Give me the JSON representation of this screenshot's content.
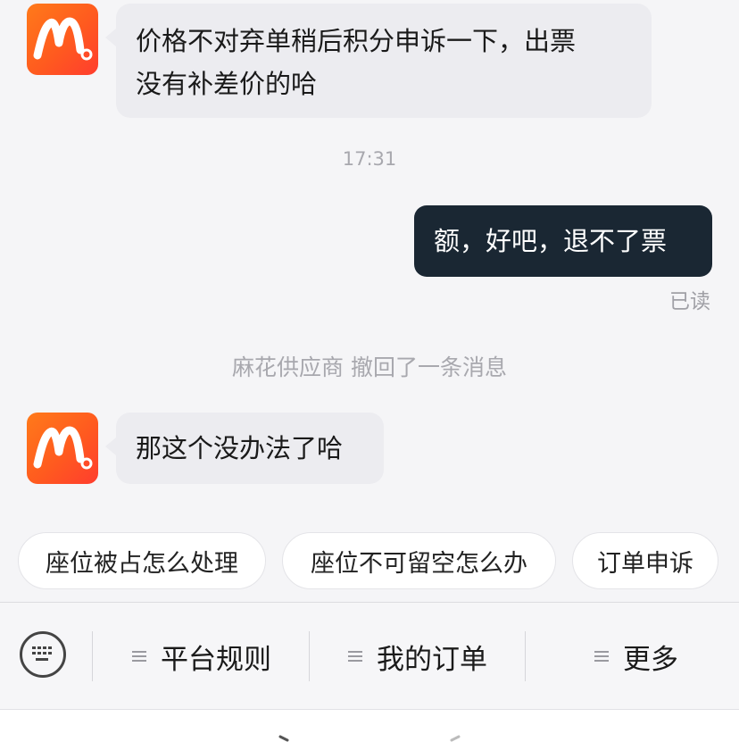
{
  "messages": {
    "incoming_1": {
      "line1": "价格不对弃单稍后积分申诉一下，出票",
      "line2": "没有补差价的哈"
    },
    "timestamp": "17:31",
    "outgoing_1": "额，好吧，退不了票",
    "read_status": "已读",
    "system_notice": "麻花供应商 撤回了一条消息",
    "incoming_2": "那这个没办法了哈"
  },
  "avatar": {
    "icon": "brand-logo-m",
    "color_top": "#ff7a1a",
    "color_bottom": "#ff3d2e"
  },
  "quick_replies": [
    "座位被占怎么处理",
    "座位不可留空怎么办",
    "订单申诉"
  ],
  "bottom_menu": {
    "keyboard_icon": "keyboard-icon",
    "items": [
      "平台规则",
      "我的订单",
      "更多"
    ]
  },
  "colors": {
    "outgoing_bubble": "#1a2733",
    "incoming_bubble": "#ececf0",
    "background": "#f5f5f7"
  }
}
